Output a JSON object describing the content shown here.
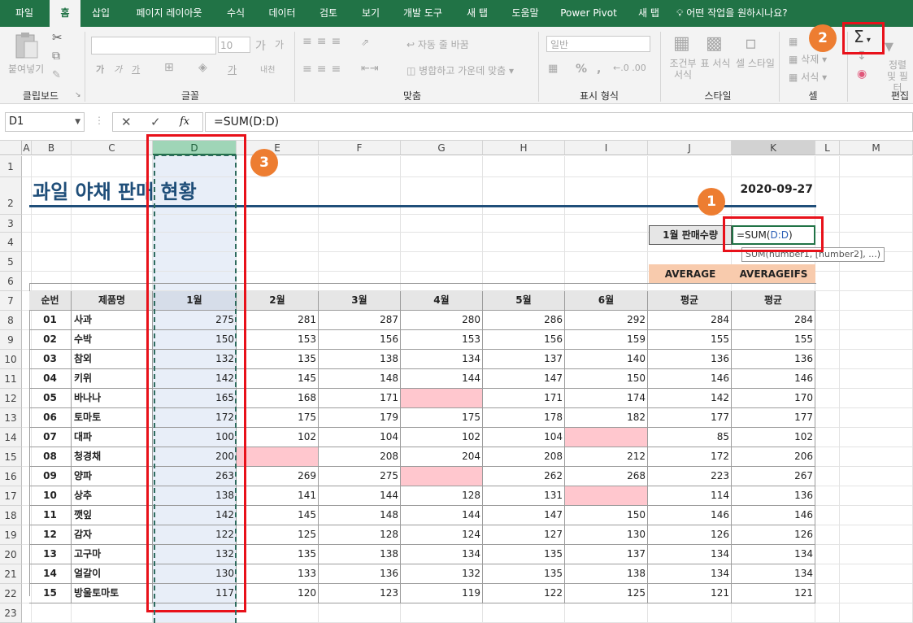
{
  "ribbon_tabs": [
    "파일",
    "홈",
    "삽입",
    "페이지 레이아웃",
    "수식",
    "데이터",
    "검토",
    "보기",
    "개발 도구",
    "새 탭",
    "도움말",
    "Power Pivot",
    "새 탭"
  ],
  "tell_me": "어떤 작업을 원하시나요?",
  "ribbon": {
    "clipboard": {
      "paste": "붙여넣기",
      "label": "클립보드"
    },
    "font": {
      "name": "",
      "size": "10",
      "bold": "가",
      "italic": "가",
      "underline": "가",
      "fontcolor": "가",
      "phonetic": "내천",
      "label": "글꼴"
    },
    "align": {
      "wrap": "자동 줄 바꿈",
      "merge": "병합하고 가운데 맞춤",
      "label": "맞춤"
    },
    "number": {
      "format": "일반",
      "percent": "%",
      "comma": ",",
      "label": "표시 형식"
    },
    "styles": {
      "cond": "조건부 서식",
      "table": "표 서식",
      "cell": "셀 스타일",
      "label": "스타일"
    },
    "cells": {
      "insert": "삽입",
      "delete": "삭제",
      "format": "서식",
      "label": "셀"
    },
    "editing": {
      "sigma": "Σ",
      "sort": "정렬 및 필터",
      "label": "편집"
    }
  },
  "formula_bar": {
    "name_box": "D1",
    "fx": "fx",
    "formula": "=SUM(D:D)"
  },
  "columns": [
    "A",
    "B",
    "C",
    "D",
    "E",
    "F",
    "G",
    "H",
    "I",
    "J",
    "K",
    "L",
    "M"
  ],
  "rows": [
    "1",
    "2",
    "3",
    "4",
    "5",
    "6",
    "7",
    "8",
    "9",
    "10",
    "11",
    "12",
    "13",
    "14",
    "15",
    "16",
    "17",
    "18",
    "19",
    "20",
    "21",
    "22",
    "23"
  ],
  "sheet": {
    "title": "과일 야채 판매 현황",
    "date": "2020-09-27",
    "input_label": "1월 판매수량",
    "input_formula_prefix": "=SUM(",
    "input_formula_ref": "D:D",
    "input_formula_suffix": ")",
    "tooltip": "SUM(number1, [number2], ...)",
    "avg_label": "AVERAGE",
    "avgifs_label": "AVERAGEIFS",
    "headers": [
      "순번",
      "제품명",
      "1월",
      "2월",
      "3월",
      "4월",
      "5월",
      "6월",
      "평균",
      "평균"
    ],
    "data": [
      [
        "01",
        "사과",
        "275",
        "281",
        "287",
        "280",
        "286",
        "292",
        "284",
        "284"
      ],
      [
        "02",
        "수박",
        "150",
        "153",
        "156",
        "153",
        "156",
        "159",
        "155",
        "155"
      ],
      [
        "03",
        "참외",
        "132",
        "135",
        "138",
        "134",
        "137",
        "140",
        "136",
        "136"
      ],
      [
        "04",
        "키위",
        "142",
        "145",
        "148",
        "144",
        "147",
        "150",
        "146",
        "146"
      ],
      [
        "05",
        "바나나",
        "165",
        "168",
        "171",
        "",
        "171",
        "174",
        "142",
        "170"
      ],
      [
        "06",
        "토마토",
        "172",
        "175",
        "179",
        "175",
        "178",
        "182",
        "177",
        "177"
      ],
      [
        "07",
        "대파",
        "100",
        "102",
        "104",
        "102",
        "104",
        "",
        "85",
        "102"
      ],
      [
        "08",
        "청경채",
        "200",
        "",
        "208",
        "204",
        "208",
        "212",
        "172",
        "206"
      ],
      [
        "09",
        "양파",
        "263",
        "269",
        "275",
        "",
        "262",
        "268",
        "223",
        "267"
      ],
      [
        "10",
        "상추",
        "138",
        "141",
        "144",
        "128",
        "131",
        "",
        "114",
        "136"
      ],
      [
        "11",
        "깻잎",
        "142",
        "145",
        "148",
        "144",
        "147",
        "150",
        "146",
        "146"
      ],
      [
        "12",
        "감자",
        "122",
        "125",
        "128",
        "124",
        "127",
        "130",
        "126",
        "126"
      ],
      [
        "13",
        "고구마",
        "132",
        "135",
        "138",
        "134",
        "135",
        "137",
        "134",
        "134"
      ],
      [
        "14",
        "얼갈이",
        "130",
        "133",
        "136",
        "132",
        "135",
        "138",
        "134",
        "134"
      ],
      [
        "15",
        "방울토마토",
        "117",
        "120",
        "123",
        "119",
        "122",
        "125",
        "121",
        "121"
      ]
    ]
  },
  "badges": [
    "1",
    "2",
    "3"
  ],
  "colors": {
    "excel_green": "#217346",
    "pink": "#ffc7ce",
    "orange_header": "#f8cbad",
    "selected_col": "#e8eef8",
    "red": "#e8111a",
    "badge": "#ed7d31",
    "title_blue": "#1f4e79"
  }
}
